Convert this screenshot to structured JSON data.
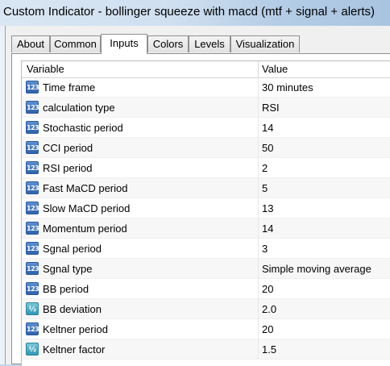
{
  "window": {
    "title": "Custom Indicator - bollinger squeeze with macd (mtf + signal + alerts)"
  },
  "tabs": [
    {
      "label": "About",
      "active": false
    },
    {
      "label": "Common",
      "active": false
    },
    {
      "label": "Inputs",
      "active": true
    },
    {
      "label": "Colors",
      "active": false
    },
    {
      "label": "Levels",
      "active": false
    },
    {
      "label": "Visualization",
      "active": false
    }
  ],
  "table": {
    "headers": {
      "variable": "Variable",
      "value": "Value"
    },
    "rows": [
      {
        "icon": "integer-icon",
        "icon_text": "123",
        "name": "Time frame",
        "value": "30 minutes"
      },
      {
        "icon": "integer-icon",
        "icon_text": "123",
        "name": "calculation type",
        "value": "RSI"
      },
      {
        "icon": "integer-icon",
        "icon_text": "123",
        "name": "Stochastic period",
        "value": "14"
      },
      {
        "icon": "integer-icon",
        "icon_text": "123",
        "name": "CCI period",
        "value": "50"
      },
      {
        "icon": "integer-icon",
        "icon_text": "123",
        "name": "RSI period",
        "value": "2"
      },
      {
        "icon": "integer-icon",
        "icon_text": "123",
        "name": "Fast MaCD period",
        "value": "5"
      },
      {
        "icon": "integer-icon",
        "icon_text": "123",
        "name": "Slow MaCD period",
        "value": "13"
      },
      {
        "icon": "integer-icon",
        "icon_text": "123",
        "name": "Momentum period",
        "value": "14"
      },
      {
        "icon": "integer-icon",
        "icon_text": "123",
        "name": "Sgnal period",
        "value": "3"
      },
      {
        "icon": "integer-icon",
        "icon_text": "123",
        "name": "Sgnal type",
        "value": "Simple moving average"
      },
      {
        "icon": "integer-icon",
        "icon_text": "123",
        "name": "BB period",
        "value": "20"
      },
      {
        "icon": "double-icon",
        "icon_text": "½",
        "name": "BB deviation",
        "value": "2.0"
      },
      {
        "icon": "integer-icon",
        "icon_text": "123",
        "name": "Keltner period",
        "value": "20"
      },
      {
        "icon": "double-icon",
        "icon_text": "½",
        "name": "Keltner factor",
        "value": "1.5"
      }
    ]
  },
  "colors": {
    "titlebar": "#cfdff0",
    "integer_icon": "#2e63ad",
    "double_icon": "#2f97b3"
  }
}
